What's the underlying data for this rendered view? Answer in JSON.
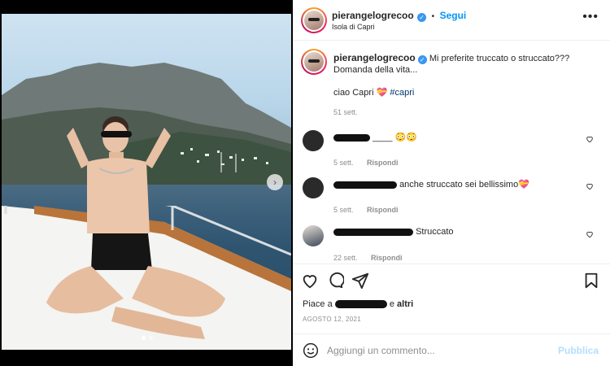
{
  "post": {
    "header": {
      "username": "pierangelogrecoo",
      "follow_label": "Segui",
      "separator": "•",
      "location": "Isola di Capri",
      "more_icon": "more-horizontal-icon"
    },
    "caption": {
      "username": "pierangelogrecoo",
      "line1": "Mi preferite truccato o struccato???",
      "line2": "Domanda della vita...",
      "line3_text": "ciao Capri 💝",
      "hashtag": "#capri",
      "time": "51 sett."
    },
    "comments": [
      {
        "text": "____ 😳😳",
        "time": "5 sett.",
        "reply_label": "Rispondi"
      },
      {
        "text": "anche struccato sei bellissimo💝",
        "time": "5 sett.",
        "reply_label": "Rispondi"
      },
      {
        "text": "Struccato",
        "time": "22 sett.",
        "reply_label": "Rispondi"
      }
    ],
    "likes": {
      "prefix": "Piace a",
      "suffix": "e",
      "others": "altri"
    },
    "date": "AGOSTO 12, 2021",
    "composer": {
      "placeholder": "Aggiungi un commento...",
      "publish_label": "Pubblica"
    }
  },
  "colors": {
    "link": "#0095f6",
    "publish_disabled": "#b2dffc",
    "hashtag": "#00376b",
    "muted": "#8e8e8e",
    "verified": "#3897f0"
  }
}
